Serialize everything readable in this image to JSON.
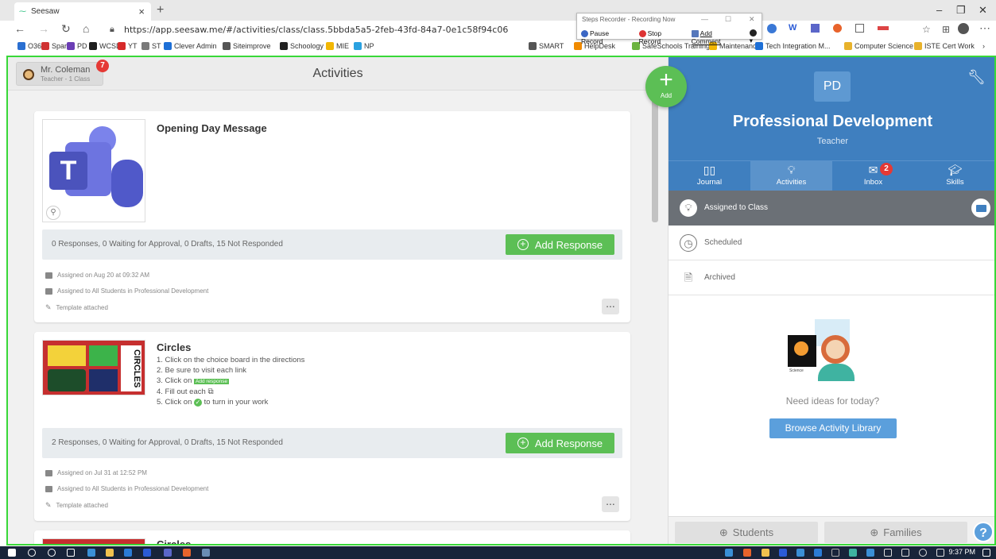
{
  "browser": {
    "tab_title": "Seesaw",
    "tab_close": "×",
    "new_tab": "+",
    "url": "https://app.seesaw.me/#/activities/class/class.5bbda5a5-2feb-43fd-84a7-0e1c58f94c06",
    "bookmarks": [
      "O365",
      "Spark",
      "PD",
      "WCSD",
      "YT",
      "ST",
      "Clever Admin",
      "Siteimprove",
      "Schoology",
      "MIE",
      "NP",
      "SMART",
      "HelpDesk",
      "SafeSchools Training",
      "Maintenance",
      "Tech Integration M...",
      "Computer Science",
      "ISTE Cert Work"
    ],
    "bookmark_colors": [
      "#2a6fd1",
      "#d03333",
      "#6b3db5",
      "#1f1f1f",
      "#d62a2a",
      "#7a7a7a",
      "#1d6fd6",
      "#555555",
      "#222222",
      "#f2b705",
      "#2aa1e0",
      "#555555",
      "#f08a00",
      "#6cb33f",
      "#f2b705",
      "#1d6fd6",
      "#e8b22b",
      "#e8b22b"
    ]
  },
  "steps_recorder": {
    "title": "Steps Recorder - Recording Now",
    "pause": "Pause Record",
    "stop": "Stop Record",
    "add_comment": "Add Comment"
  },
  "topbar": {
    "user_name": "Mr. Coleman",
    "user_role": "Teacher - 1 Class",
    "notifications": "7",
    "title": "Activities"
  },
  "fab": {
    "label": "Add",
    "symbol": "+"
  },
  "activities": [
    {
      "title": "Opening Day Message",
      "thumb_letter": "T",
      "responses": "0 Responses, 0 Waiting for Approval, 0 Drafts, 15 Not Responded",
      "add_response": "Add Response",
      "assigned_on": "Assigned on Aug 20 at 09:32 AM",
      "assigned_to": "Assigned to All Students in Professional Development",
      "template": "Template attached",
      "more": "..."
    },
    {
      "title": "Circles",
      "steps": [
        "1. Click on the choice board in the directions",
        "2. Be sure to visit each link",
        "3. Click on",
        "4. Fill out each",
        "5. Click on",
        "to turn in your work"
      ],
      "inline_btn": "Add response",
      "thumb_word": "CIRCLES",
      "responses": "2 Responses, 0 Waiting for Approval, 0 Drafts, 15 Not Responded",
      "add_response": "Add Response",
      "assigned_on": "Assigned on Jul 31 at 12:52 PM",
      "assigned_to": "Assigned to All Students in Professional Development",
      "template": "Template attached",
      "more": "..."
    },
    {
      "title": "Circles"
    }
  ],
  "class_panel": {
    "initials": "PD",
    "name": "Professional Development",
    "role": "Teacher",
    "tabs": [
      {
        "label": "Journal",
        "icon": "book-icon"
      },
      {
        "label": "Activities",
        "icon": "bulb-icon"
      },
      {
        "label": "Inbox",
        "icon": "inbox-icon",
        "badge": "2"
      },
      {
        "label": "Skills",
        "icon": "graduation-cap-icon"
      }
    ],
    "filters": [
      "Assigned to Class",
      "Scheduled",
      "Archived"
    ],
    "empty_text": "Need ideas for today?",
    "illustration_caption": "Science",
    "browse_label": "Browse Activity Library",
    "footer": {
      "students": "Students",
      "families": "Families",
      "help": "?"
    }
  },
  "taskbar": {
    "time": "9:37 PM"
  },
  "colors": {
    "seesaw_blue": "#3f7fbf",
    "green": "#5cbf55",
    "badge_red": "#e53935",
    "frame_green": "#38d838"
  }
}
